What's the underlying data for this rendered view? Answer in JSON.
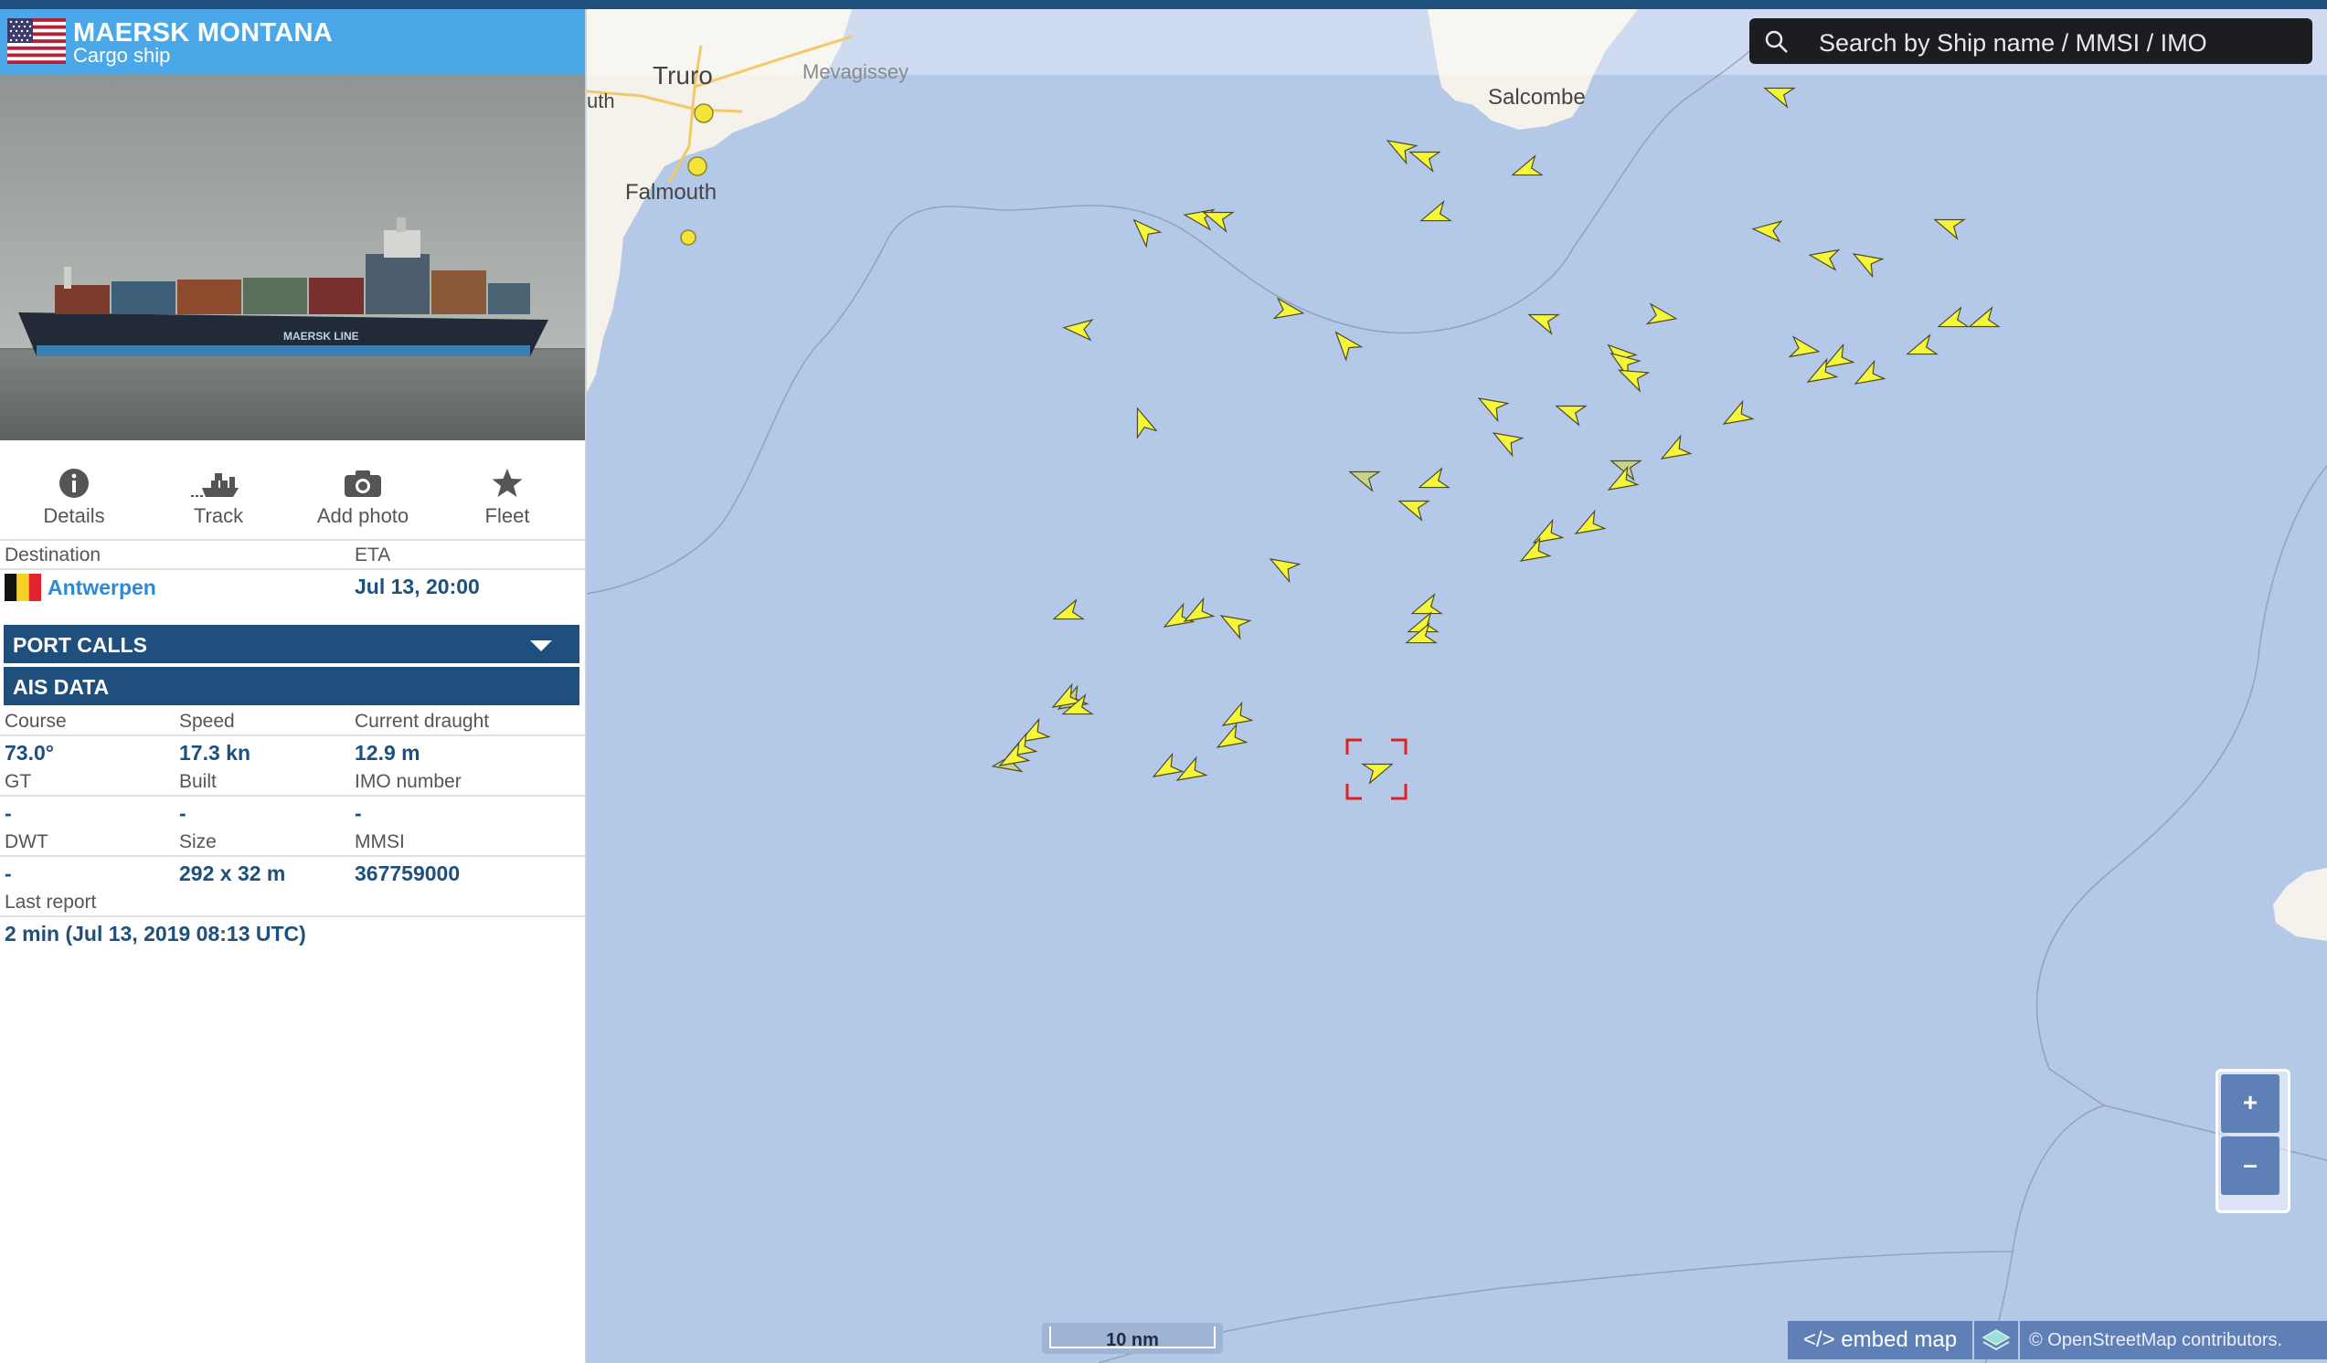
{
  "vessel": {
    "name": "MAERSK MONTANA",
    "type": "Cargo ship",
    "flag_icon": "us-flag-icon",
    "photo_hull_text": "MAERSK LINE"
  },
  "tabs": [
    {
      "label": "Details",
      "icon": "info-icon"
    },
    {
      "label": "Track",
      "icon": "ship-track-icon"
    },
    {
      "label": "Add photo",
      "icon": "camera-icon"
    },
    {
      "label": "Fleet",
      "icon": "star-icon"
    }
  ],
  "voyage": {
    "destination_label": "Destination",
    "destination_value": "Antwerpen",
    "destination_flag_icon": "belgium-flag-icon",
    "eta_label": "ETA",
    "eta_value": "Jul 13, 20:00"
  },
  "sections": {
    "port_calls": "PORT CALLS",
    "ais_data": "AIS DATA"
  },
  "ais": {
    "course_label": "Course",
    "course_value": "73.0°",
    "speed_label": "Speed",
    "speed_value": "17.3 kn",
    "draught_label": "Current draught",
    "draught_value": "12.9 m",
    "gt_label": "GT",
    "gt_value": "-",
    "built_label": "Built",
    "built_value": "-",
    "imo_label": "IMO number",
    "imo_value": "-",
    "dwt_label": "DWT",
    "dwt_value": "-",
    "size_label": "Size",
    "size_value": "292 x 32 m",
    "mmsi_label": "MMSI",
    "mmsi_value": "367759000",
    "last_report_label": "Last report",
    "last_report_value": "2 min (Jul 13, 2019 08:13 UTC)"
  },
  "map": {
    "search_placeholder": "Search by Ship name / MMSI / IMO",
    "zoom_in_label": "+",
    "zoom_out_label": "–",
    "scale_label": "10 nm",
    "embed_label": "</> embed map",
    "attribution": "© OpenStreetMap contributors.",
    "places": [
      "Truro",
      "Mevagissey",
      "Falmouth",
      "Salcombe",
      "uth"
    ],
    "colors": {
      "sea": "#b4c8e8",
      "land": "#f4f2ea",
      "ship": "#f5f53a",
      "ship_faded": "#c6d48c",
      "selection": "#e02020"
    }
  }
}
